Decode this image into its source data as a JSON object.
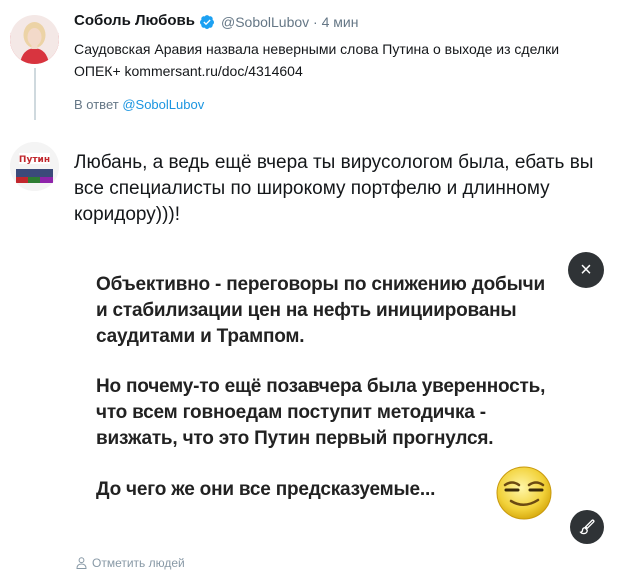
{
  "original_tweet": {
    "author_name": "Соболь Любовь",
    "handle_time": "@SobolLubov · 4 мин",
    "text_line1": "Саудовская Аравия назвала неверными слова Путина о выходе из сделки",
    "text_line2": "ОПЕК+  kommersant.ru/doc/4314604"
  },
  "reply_context": {
    "prefix": "В ответ",
    "mention": "@SobolLubov"
  },
  "reply": {
    "text": "Любань, а ведь ещё вчера ты вирусологом была, ебать вы все специалисты по широкому портфелю и длинному коридору)))!",
    "avatar_label": "Путин"
  },
  "attached_image": {
    "lines": [
      "Объективно - переговоры по снижению добычи",
      "и стабилизации цен на нефть инициированы",
      "саудитами и Трампом.",
      "Но почему-то ещё позавчера была уверенность,",
      "что всем говноедам поступит методичка -",
      "визжать, что это Путин первый прогнулся.",
      "До чего же они все предсказуемые..."
    ]
  },
  "actions": {
    "close_glyph": "×",
    "tag_people": "Отметить людей"
  },
  "colors": {
    "link": "#1b95e0",
    "muted": "#657786",
    "verified": "#1da1f2",
    "overlay_button": "#2f3336"
  }
}
